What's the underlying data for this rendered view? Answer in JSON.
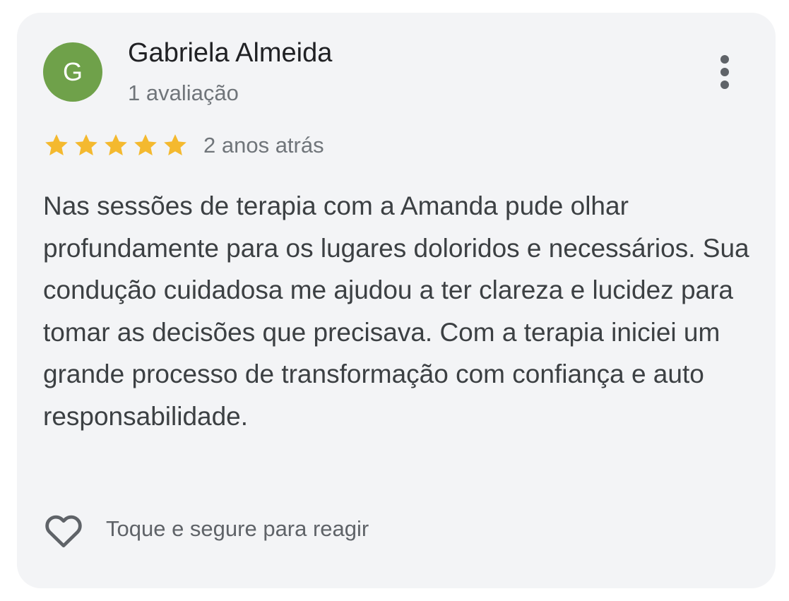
{
  "review": {
    "author_initial": "G",
    "author_name": "Gabriela Almeida",
    "review_count": "1 avaliação",
    "rating": 5,
    "rating_max": 5,
    "time_ago": "2 anos atrás",
    "text": "Nas sessões de terapia com a Amanda pude olhar profundamente para os lugares doloridos e necessários. Sua condução cuidadosa me ajudou a ter clareza e lucidez para tomar as decisões que precisava. Com a terapia iniciei um grande processo de transformação com confiança e auto responsabilidade.",
    "react_label": "Toque e segure para reagir"
  },
  "icons": {
    "menu": "more-vertical-icon",
    "star": "star-icon",
    "react": "heart-outline-icon"
  },
  "colors": {
    "card_background": "#f3f4f6",
    "avatar": "#6fa14a",
    "star": "#f4b92f",
    "name_text": "#202124",
    "secondary_text": "#70757a",
    "body_text": "#3c4043"
  }
}
